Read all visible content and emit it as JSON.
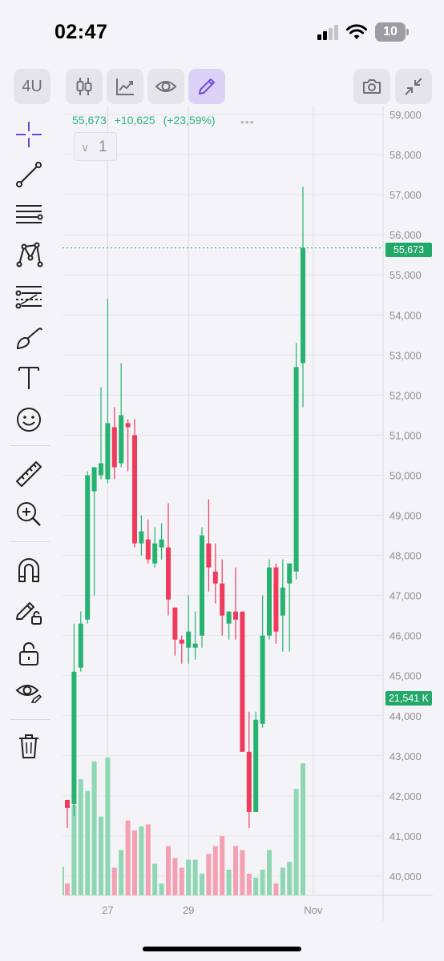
{
  "status_bar": {
    "time": "02:47",
    "battery_level": "10"
  },
  "toolbar": {
    "timeframe_label": "4U",
    "buttons": [
      "candles-icon",
      "indicators-icon",
      "eye-icon",
      "pencil-icon",
      "camera-icon",
      "collapse-icon"
    ],
    "active_button": "pencil-icon",
    "accent_color": "#6c4ad6"
  },
  "left_tools": [
    "crosshair-icon",
    "trend-line-icon",
    "fib-retracement-icon",
    "pattern-icon",
    "projection-icon",
    "brush-icon",
    "text-icon",
    "emoji-icon",
    "ruler-icon",
    "zoom-in-icon",
    "magnet-icon",
    "lock-drawing-icon",
    "unlock-icon",
    "hide-drawings-icon",
    "trash-icon"
  ],
  "legend": {
    "last": "55,673",
    "change": "+10,625",
    "change_pct": "(+23,59%)",
    "dots": "•••"
  },
  "indicator_collapse": {
    "chevron": "∨",
    "count": "1"
  },
  "price_tags": {
    "last_price": "55,673",
    "volume": "21,541 K"
  },
  "colors": {
    "up": "#26b36f",
    "down": "#ef3b5c",
    "up_volume": "#8fd7b2",
    "down_volume": "#f4a0b3",
    "background": "#f3f3f8"
  },
  "chart_data": {
    "type": "candlestick",
    "y_ticks": [
      "59,000",
      "58,000",
      "57,000",
      "56,000",
      "55,000",
      "54,000",
      "53,000",
      "52,000",
      "51,000",
      "50,000",
      "49,000",
      "48,000",
      "47,000",
      "46,000",
      "45,000",
      "44,000",
      "43,000",
      "42,000",
      "41,000",
      "40,000"
    ],
    "ylim": [
      39500,
      59200
    ],
    "x_ticks": [
      "27",
      "29",
      "Nov"
    ],
    "x_tick_index": [
      6,
      18,
      37
    ],
    "last_price": 55673,
    "grid": true,
    "candles": [
      {
        "o": 41900,
        "h": 41900,
        "l": 41200,
        "c": 41700,
        "v": 0.06
      },
      {
        "o": 41800,
        "h": 46300,
        "l": 41500,
        "c": 45100,
        "v": 0.46
      },
      {
        "o": 45200,
        "h": 46600,
        "l": 45100,
        "c": 46300,
        "v": 0.59
      },
      {
        "o": 46400,
        "h": 50100,
        "l": 46300,
        "c": 50000,
        "v": 0.53
      },
      {
        "o": 49600,
        "h": 50200,
        "l": 47000,
        "c": 50200,
        "v": 0.68
      },
      {
        "o": 50000,
        "h": 52200,
        "l": 49900,
        "c": 50300,
        "v": 0.4
      },
      {
        "o": 49900,
        "h": 54400,
        "l": 49800,
        "c": 51300,
        "v": 0.7
      },
      {
        "o": 51200,
        "h": 51700,
        "l": 49900,
        "c": 50200,
        "v": 0.14
      },
      {
        "o": 50300,
        "h": 52800,
        "l": 50200,
        "c": 51500,
        "v": 0.23
      },
      {
        "o": 51300,
        "h": 51400,
        "l": 50100,
        "c": 51200,
        "v": 0.38
      },
      {
        "o": 51000,
        "h": 51400,
        "l": 48200,
        "c": 48300,
        "v": 0.33
      },
      {
        "o": 48300,
        "h": 49000,
        "l": 48000,
        "c": 48600,
        "v": 0.35
      },
      {
        "o": 48400,
        "h": 48900,
        "l": 47800,
        "c": 47900,
        "v": 0.36
      },
      {
        "o": 47800,
        "h": 48700,
        "l": 47700,
        "c": 48300,
        "v": 0.16
      },
      {
        "o": 48200,
        "h": 48800,
        "l": 47900,
        "c": 48400,
        "v": 0.06
      },
      {
        "o": 48200,
        "h": 49300,
        "l": 46500,
        "c": 46900,
        "v": 0.25
      },
      {
        "o": 46700,
        "h": 46700,
        "l": 45500,
        "c": 45900,
        "v": 0.19
      },
      {
        "o": 45900,
        "h": 46000,
        "l": 45300,
        "c": 45800,
        "v": 0.14
      },
      {
        "o": 45700,
        "h": 47000,
        "l": 45300,
        "c": 46100,
        "v": 0.18
      },
      {
        "o": 45700,
        "h": 46600,
        "l": 45400,
        "c": 45800,
        "v": 0.18
      },
      {
        "o": 46000,
        "h": 48700,
        "l": 45700,
        "c": 48500,
        "v": 0.11
      },
      {
        "o": 48300,
        "h": 49400,
        "l": 47100,
        "c": 47700,
        "v": 0.21
      },
      {
        "o": 47600,
        "h": 48300,
        "l": 46800,
        "c": 47300,
        "v": 0.25
      },
      {
        "o": 47300,
        "h": 47900,
        "l": 46000,
        "c": 46500,
        "v": 0.3
      },
      {
        "o": 46300,
        "h": 46600,
        "l": 45900,
        "c": 46600,
        "v": 0.13
      },
      {
        "o": 46600,
        "h": 47700,
        "l": 45900,
        "c": 46400,
        "v": 0.25
      },
      {
        "o": 46600,
        "h": 46600,
        "l": 43900,
        "c": 43100,
        "v": 0.23
      },
      {
        "o": 43100,
        "h": 44100,
        "l": 41200,
        "c": 41600,
        "v": 0.11
      },
      {
        "o": 41600,
        "h": 44100,
        "l": 41600,
        "c": 43900,
        "v": 0.09
      },
      {
        "o": 43800,
        "h": 47000,
        "l": 43700,
        "c": 46000,
        "v": 0.13
      },
      {
        "o": 46000,
        "h": 47900,
        "l": 45900,
        "c": 47700,
        "v": 0.23
      },
      {
        "o": 47700,
        "h": 47800,
        "l": 45800,
        "c": 46100,
        "v": 0.06
      },
      {
        "o": 46500,
        "h": 47900,
        "l": 45600,
        "c": 47200,
        "v": 0.14
      },
      {
        "o": 47300,
        "h": 47800,
        "l": 45600,
        "c": 47800,
        "v": 0.17
      },
      {
        "o": 47600,
        "h": 53300,
        "l": 47400,
        "c": 52700,
        "v": 0.54
      },
      {
        "o": 52800,
        "h": 57200,
        "l": 51700,
        "c": 55673,
        "v": 0.67
      }
    ]
  }
}
